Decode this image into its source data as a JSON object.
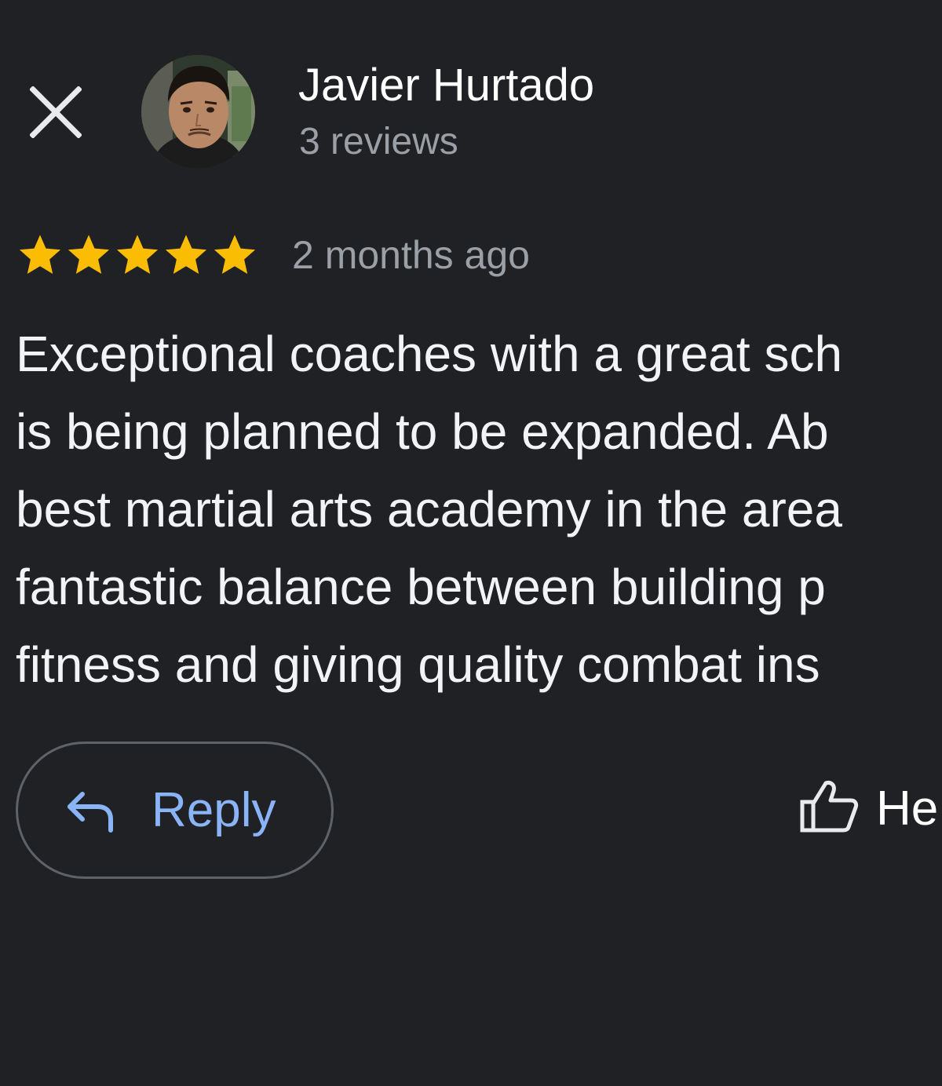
{
  "header": {
    "close_icon": "close-icon",
    "author_name": "Javier Hurtado",
    "review_count": "3 reviews"
  },
  "review": {
    "rating": 5,
    "rating_max": 5,
    "star_color": "#fbbc04",
    "time_ago": "2 months ago",
    "text_lines": [
      "Exceptional coaches with a great sch",
      "is being planned to be expanded. Ab",
      "best martial arts academy in the area",
      "fantastic balance between building p",
      "fitness and giving quality combat ins"
    ]
  },
  "actions": {
    "reply_label": "Reply",
    "reply_icon": "reply-arrow-icon",
    "helpful_label": "He",
    "helpful_icon": "thumbs-up-icon"
  },
  "colors": {
    "background": "#202124",
    "accent": "#8ab4f8",
    "secondary_text": "#9aa0a6"
  }
}
